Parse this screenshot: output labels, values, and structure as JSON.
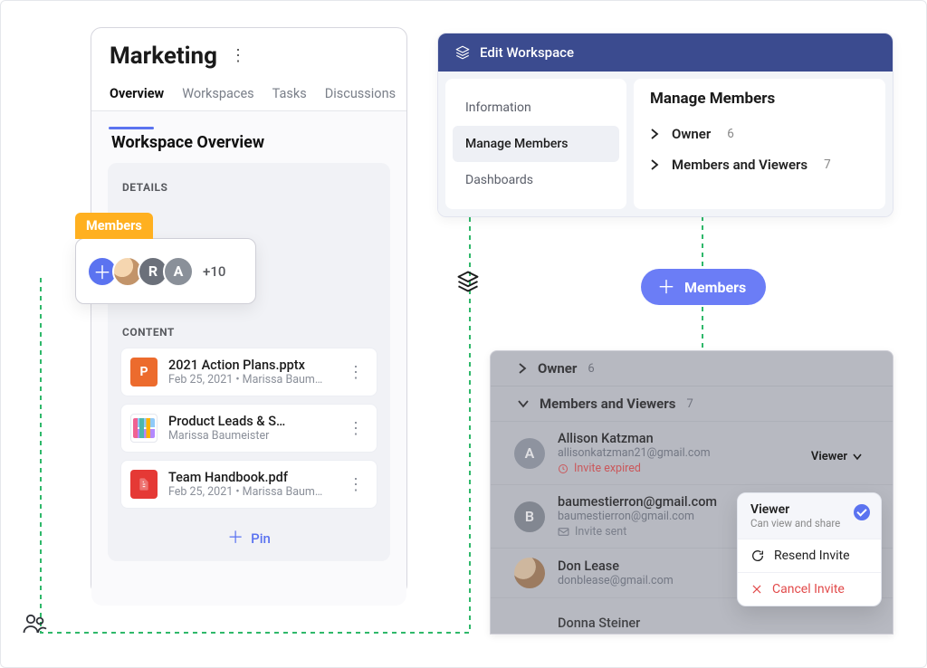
{
  "left": {
    "title": "Marketing",
    "tabs": [
      "Overview",
      "Workspaces",
      "Tasks",
      "Discussions"
    ],
    "active_tab": "Overview",
    "section_title": "Workspace Overview",
    "details_label": "DETAILS",
    "members_label": "Members",
    "avatars": {
      "r": "R",
      "a": "A"
    },
    "more_count": "+10",
    "content_label": "CONTENT",
    "files": [
      {
        "name": "2021 Action Plans.pptx",
        "meta": "Feb 25, 2021  •  Marissa Baum…"
      },
      {
        "name": "Product Leads & S…",
        "meta": "Marissa Baumeister"
      },
      {
        "name": "Team Handbook.pdf",
        "meta": "Feb 25, 2021  •  Marissa Baum…"
      }
    ],
    "pin_label": "Pin"
  },
  "members_pill": {
    "label": "Members"
  },
  "right_panel": {
    "header": "Edit Workspace",
    "side_items": [
      "Information",
      "Manage Members",
      "Dashboards"
    ],
    "active_side": "Manage Members",
    "main_title": "Manage Members",
    "groups": [
      {
        "label": "Owner",
        "count": "6"
      },
      {
        "label": "Members and Viewers",
        "count": "7"
      }
    ]
  },
  "mem_panel": {
    "groups": [
      {
        "label": "Owner",
        "count": "6"
      },
      {
        "label": "Members and Viewers",
        "count": "7"
      }
    ],
    "rows": [
      {
        "avatar": "A",
        "name": "Allison Katzman",
        "email": "allisonkatzman21@gmail.com",
        "invite": "Invite expired",
        "invite_kind": "expired"
      },
      {
        "avatar": "B",
        "name": "baumestierron@gmail.com",
        "email": "baumestierron@gmail.com",
        "invite": "Invite sent",
        "invite_kind": "sent"
      },
      {
        "avatar": "photo",
        "name": "Don Lease",
        "email": "donblease@gmail.com",
        "invite": "",
        "invite_kind": "none"
      },
      {
        "avatar": "",
        "name": "Donna Steiner",
        "email": "",
        "invite": "",
        "invite_kind": "none"
      }
    ],
    "viewer_chip": "Viewer",
    "dropdown": {
      "selected_title": "Viewer",
      "selected_sub": "Can view and share",
      "resend": "Resend Invite",
      "cancel": "Cancel Invite"
    }
  }
}
